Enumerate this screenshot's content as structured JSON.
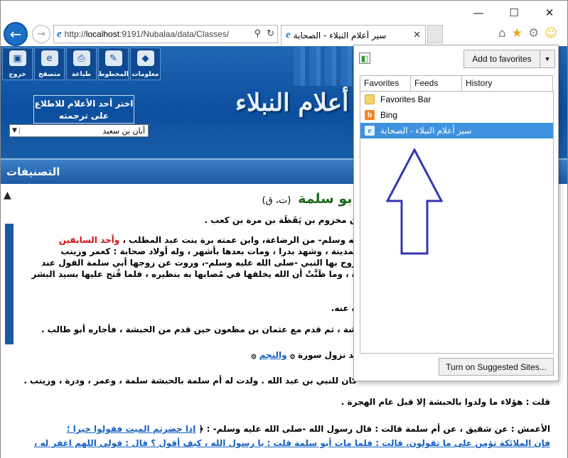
{
  "window": {
    "controls": {
      "minimize": "—",
      "maximize": "☐",
      "close": "✕"
    }
  },
  "browser": {
    "address_scheme": "http://",
    "address_host": "localhost",
    "address_rest": ":9191/Nubalaa/data/Classes/",
    "tab_title": "سير أعلام النبلاء - الصحابة"
  },
  "site": {
    "toolbar": [
      {
        "label": "خروج",
        "icon": "exit-icon",
        "glyph": "▣"
      },
      {
        "label": "متصفح",
        "icon": "browser-icon",
        "glyph": "e"
      },
      {
        "label": "طباعة",
        "icon": "print-icon",
        "glyph": "⎙"
      },
      {
        "label": "المخطوط",
        "icon": "manuscript-icon",
        "glyph": "✎"
      },
      {
        "label": "معلومات",
        "icon": "info-icon",
        "glyph": "◆"
      }
    ],
    "choose_prompt_line1": "اختر أحد الأعلام للاطلاع",
    "choose_prompt_line2": "على ترجمته",
    "selected_person": "أبان بن سعيد",
    "title": "أعلام النبلاء",
    "categories_label": "التصنيفات"
  },
  "article": {
    "name": "أبو سلمة",
    "code": "(ت، ق)",
    "lines": [
      "ن مخزوم بن يَقَظَة بن مرة بن كعب .",
      "يه وسلم- من الرضاعة، وابن عمته برة بنت عبد المطلب ،",
      "وأحد السابقين",
      "لمدينة ، وشهد بدرا ، ومات بعدها بأشهر ، وله أولاد صحابة : كعمر وزينب",
      "زوج بها النبي -صلى الله عليه وسلم-، وروت عن زوجها أبي سلمة القول عند",
      "ة ، وما ظَنَّتْ أن الله يخلفها في مُصابها به بنظيره ، فلما فُتح عليها بسيد البشر",
      "ه عنه.",
      "شة ، ثم قدم مع عثمان بن مظعون حين قدم من الحبشة ، فأجاره أبو طالب .",
      "ند نزول سورة",
      "والنجم",
      "كان للنبي بن عبد الله . ولدت له أم سلمة بالحبشة سلمة ، وعمر ، ودرة ، وزينب .",
      "قلت : هؤلاء ما ولدوا بالحبشة إلا قبل عام الهجرة .",
      "الأعمش : عن شقيق ، عن أم سلمة قالت : قال رسول الله -صلى الله عليه وسلم- :",
      "إذا حضرتم الميت فقولوا خيرا ؛",
      "فإن الملائكة تؤمن على ما تقولون. قالت : فلما مات أبو سلمة قلت : يا رسول الله ، كيف أقول ؟ قال : قولي اللهم اغفر له ،"
    ]
  },
  "favorites_center": {
    "add_button": "Add to favorites",
    "tabs": [
      "Favorites",
      "Feeds",
      "History"
    ],
    "items": [
      {
        "label": "Favorites Bar",
        "icon": "folder-icon"
      },
      {
        "label": "Bing",
        "icon": "bing-icon"
      },
      {
        "label": "سير أعلام النبلاء - الصحابة",
        "icon": "page-icon",
        "selected": true
      }
    ],
    "suggested_button": "Turn on Suggested Sites...",
    "arrow_color": "#3535b5"
  }
}
